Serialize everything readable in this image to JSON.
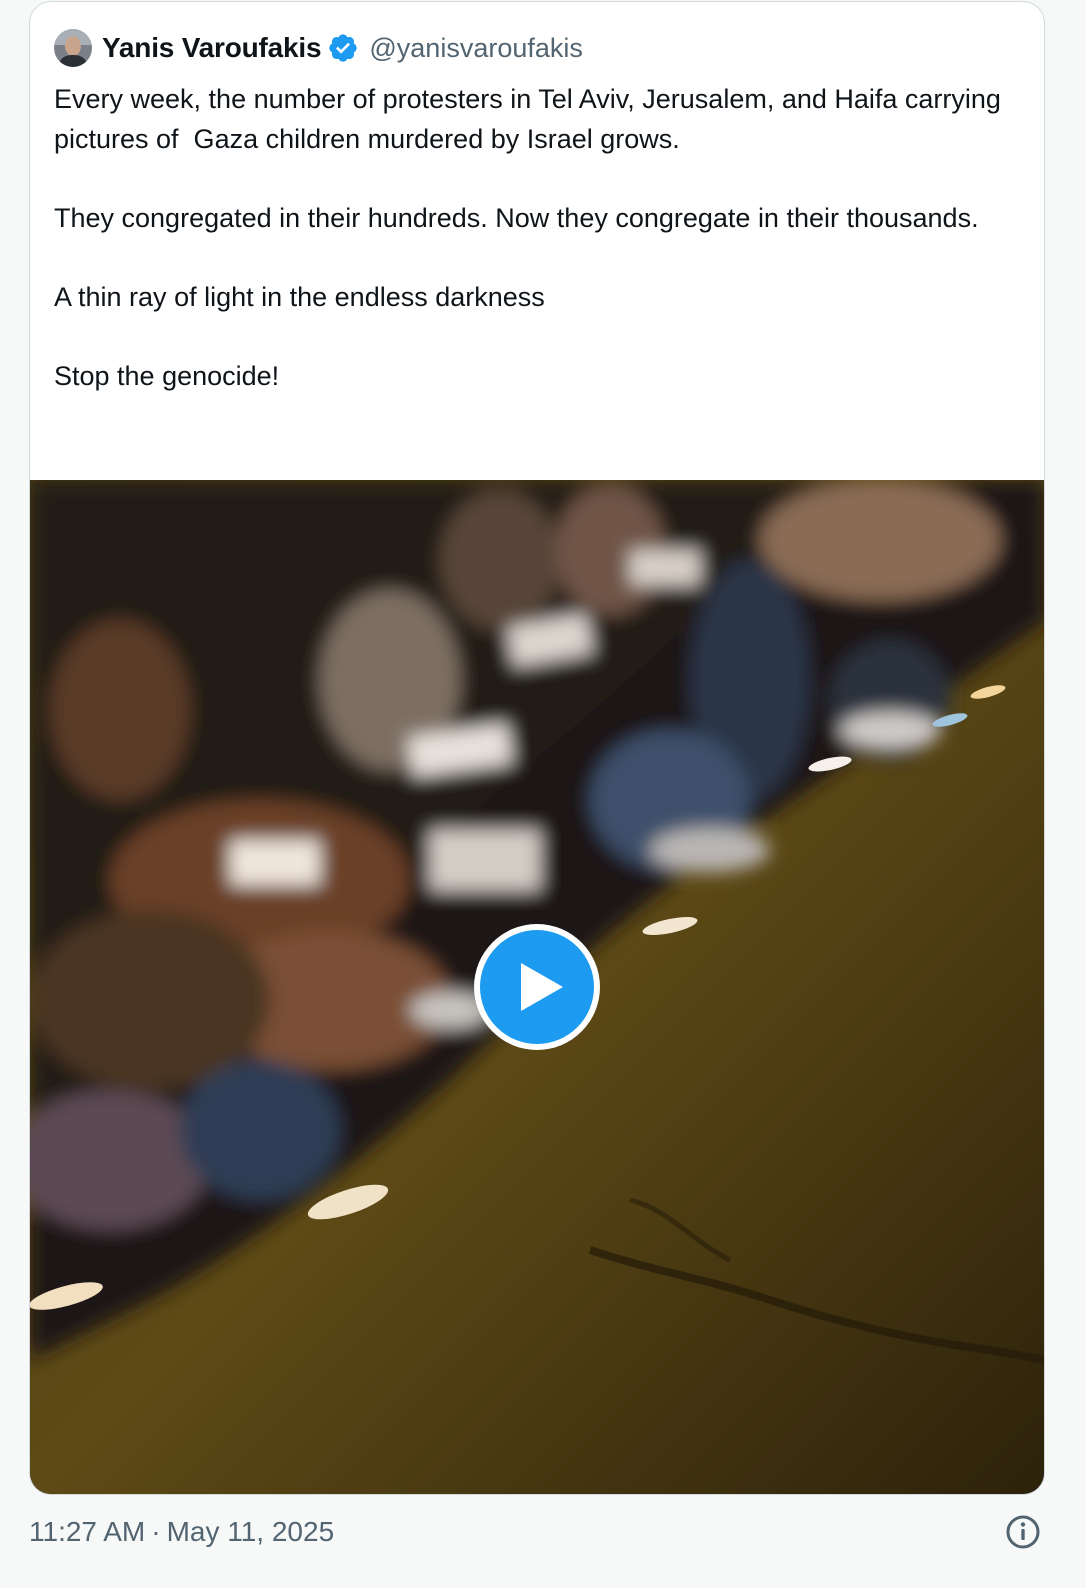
{
  "tweet": {
    "author": {
      "display_name": "Yanis Varoufakis",
      "handle": "@yanisvaroufakis",
      "verified_icon": "verified-badge-icon",
      "avatar_icon": "avatar"
    },
    "text": "Every week, the number of protesters in Tel Aviv, Jerusalem, and Haifa carrying pictures of  Gaza children murdered by Israel grows.\n\nThey congregated in their hundreds. Now they congregate in their thousands.\n\nA thin ray of light in the endless darkness\n\nStop the genocide!",
    "media": {
      "type": "video",
      "play_icon": "play-icon"
    },
    "footer": {
      "time": "11:27 AM",
      "separator": "·",
      "date": "May 11, 2025",
      "info_icon": "info-icon"
    }
  },
  "colors": {
    "accent": "#1d9bf0",
    "text_primary": "#0f1419",
    "text_secondary": "#536471",
    "border": "#cfd9de",
    "background": "#f7f9f9"
  }
}
